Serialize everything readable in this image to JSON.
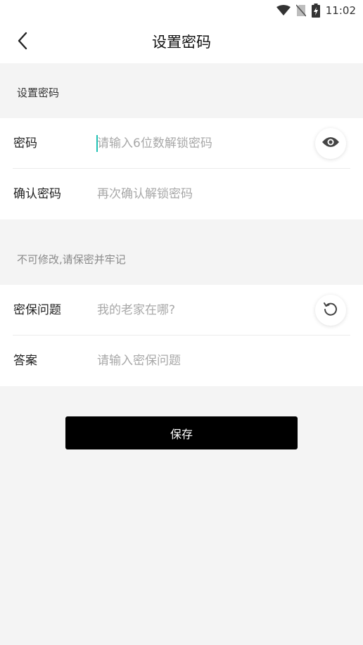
{
  "status_bar": {
    "time": "11:02",
    "icons": [
      "wifi-icon",
      "no-sim-icon",
      "battery-charging-icon"
    ]
  },
  "header": {
    "title": "设置密码",
    "back_icon": "chevron-left-icon"
  },
  "password_section": {
    "label": "设置密码",
    "password": {
      "label": "密码",
      "placeholder": "请输入6位数解锁密码",
      "value": "",
      "toggle_icon": "eye-icon"
    },
    "confirm": {
      "label": "确认密码",
      "placeholder": "再次确认解锁密码",
      "value": ""
    }
  },
  "security_section": {
    "note": "不可修改,请保密并牢记",
    "question": {
      "label": "密保问题",
      "placeholder": "我的老家在哪?",
      "refresh_icon": "refresh-icon"
    },
    "answer": {
      "label": "答案",
      "placeholder": "请输入密保问题",
      "value": ""
    }
  },
  "save_label": "保存",
  "colors": {
    "accent_caret": "#1fc1b4",
    "button_bg": "#000000",
    "page_bg": "#f4f4f4"
  }
}
